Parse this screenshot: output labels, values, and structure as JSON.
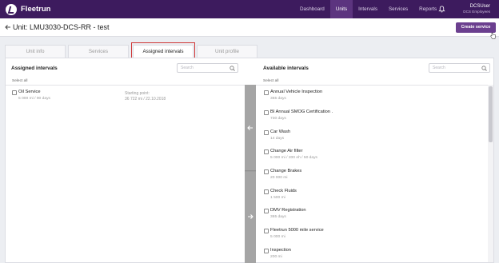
{
  "app": {
    "name": "Fleetrun"
  },
  "nav": {
    "items": [
      {
        "label": "Dashboard",
        "active": false
      },
      {
        "label": "Units",
        "active": true
      },
      {
        "label": "Intervals",
        "active": false
      },
      {
        "label": "Services",
        "active": false
      },
      {
        "label": "Reports",
        "active": false
      }
    ]
  },
  "user": {
    "name": "DCSUser",
    "role": "DCS Employees"
  },
  "header": {
    "title": "Unit: LMU3030-DCS-RR - test",
    "create_label": "Create service"
  },
  "tabs": [
    {
      "label": "Unit info",
      "active": false
    },
    {
      "label": "Services",
      "active": false
    },
    {
      "label": "Assigned intervals",
      "active": true
    },
    {
      "label": "Unit profile",
      "active": false
    }
  ],
  "assigned": {
    "title": "Assigned intervals",
    "search_placeholder": "Search",
    "select_all": "Select all",
    "items": [
      {
        "name": "Oil Service",
        "detail": "5 000 mi / 90 days",
        "start_label": "Starting point:",
        "start_value": "36 722 mi / 22.10.2018"
      }
    ]
  },
  "available": {
    "title": "Available intervals",
    "search_placeholder": "Search",
    "select_all": "Select all",
    "items": [
      {
        "name": "Annual Vehicle Inspection",
        "detail": "365 days"
      },
      {
        "name": "BI Annual SMOG Certification .",
        "detail": "730 days"
      },
      {
        "name": "Car Wash",
        "detail": "14 days"
      },
      {
        "name": "Change Air filter",
        "detail": "5 000 mi / 200 eh / 50 days"
      },
      {
        "name": "Change Brakes",
        "detail": "20 000 mi"
      },
      {
        "name": "Check Fluids",
        "detail": "1 500 mi"
      },
      {
        "name": "DMV Registration",
        "detail": "365 days"
      },
      {
        "name": "Fleetrun 5000 mile service",
        "detail": "5 000 mi"
      },
      {
        "name": "Inspection",
        "detail": "200 mi"
      }
    ]
  }
}
